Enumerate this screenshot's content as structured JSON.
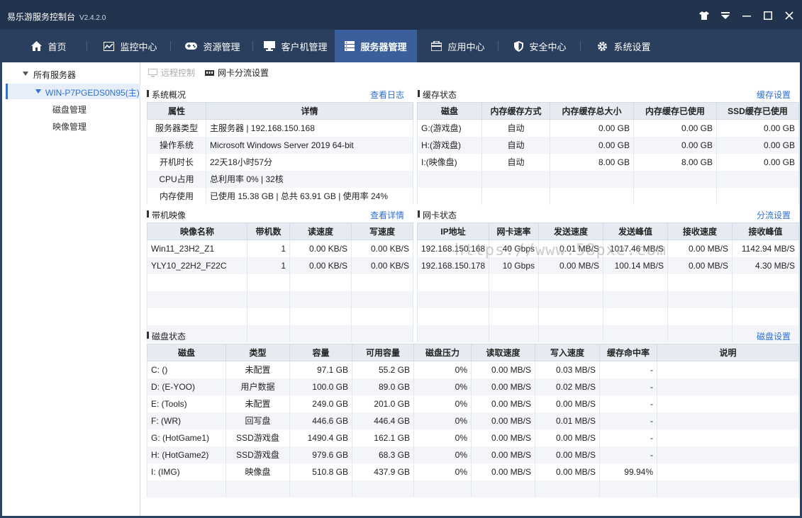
{
  "app": {
    "title": "易乐游服务控制台",
    "version": "V2.4.2.0"
  },
  "window_controls": [
    "skin-icon",
    "dropdown-icon",
    "minimize-icon",
    "maximize-icon",
    "close-icon"
  ],
  "nav": {
    "tabs": [
      {
        "label": "首页",
        "icon": "home-icon"
      },
      {
        "label": "监控中心",
        "icon": "monitor-icon"
      },
      {
        "label": "资源管理",
        "icon": "gamepad-icon"
      },
      {
        "label": "客户机管理",
        "icon": "computer-icon"
      },
      {
        "label": "服务器管理",
        "icon": "server-icon",
        "active": true
      },
      {
        "label": "应用中心",
        "icon": "app-icon"
      },
      {
        "label": "安全中心",
        "icon": "shield-icon"
      },
      {
        "label": "系统设置",
        "icon": "gear-icon"
      }
    ],
    "active_color": "#3a5f9a"
  },
  "sidebar": {
    "root": "所有服务器",
    "server": "WIN-P7PGEDS0N95(主)",
    "items": [
      "磁盘管理",
      "映像管理"
    ]
  },
  "toolbar": {
    "remote": "远程控制",
    "nic_split": "网卡分流设置"
  },
  "overview": {
    "title": "系统概况",
    "link": "查看日志",
    "headers": [
      "属性",
      "详情"
    ],
    "rows": [
      [
        "服务器类型",
        "主服务器 | 192.168.150.168"
      ],
      [
        "操作系统",
        "Microsoft Windows Server 2019 64-bit"
      ],
      [
        "开机时长",
        "22天18小时57分"
      ],
      [
        "CPU占用",
        "总利用率 0% | 32核"
      ],
      [
        "内存使用",
        "已使用 15.38 GB | 总共 63.91 GB | 使用率 24%"
      ]
    ]
  },
  "cache": {
    "title": "缓存状态",
    "link": "缓存设置",
    "headers": [
      "磁盘",
      "内存缓存方式",
      "内存缓存总大小",
      "内存缓存已使用",
      "SSD缓存已使用"
    ],
    "rows": [
      [
        "G:(游戏盘)",
        "自动",
        "0.00 GB",
        "0.00 GB",
        "0.00 GB"
      ],
      [
        "H:(游戏盘)",
        "自动",
        "0.00 GB",
        "0.00 GB",
        "0.00 GB"
      ],
      [
        "I:(映像盘)",
        "自动",
        "8.00 GB",
        "8.00 GB",
        "0.00 GB"
      ]
    ]
  },
  "boot_images": {
    "title": "带机映像",
    "link": "查看详情",
    "headers": [
      "映像名称",
      "带机数",
      "读速度",
      "写速度"
    ],
    "rows": [
      [
        "Win11_23H2_Z1",
        "1",
        "0.00 KB/S",
        "0.00 KB/S"
      ],
      [
        "YLY10_22H2_F22C",
        "1",
        "0.00 KB/S",
        "0.00 KB/S"
      ]
    ]
  },
  "nic": {
    "title": "网卡状态",
    "link": "分流设置",
    "headers": [
      "IP地址",
      "网卡速率",
      "发送速度",
      "发送峰值",
      "接收速度",
      "接收峰值"
    ],
    "rows": [
      [
        "192.168.150.168",
        "40 Gbps",
        "0.01 MB/S",
        "1017.46 MB/S",
        "0.00 MB/S",
        "1142.94 MB/S"
      ],
      [
        "192.168.150.178",
        "10 Gbps",
        "0.00 MB/S",
        "100.14 MB/S",
        "0.00 MB/S",
        "4.30 MB/S"
      ]
    ]
  },
  "disk": {
    "title": "磁盘状态",
    "link": "磁盘设置",
    "headers": [
      "磁盘",
      "类型",
      "容量",
      "可用容量",
      "磁盘压力",
      "读取速度",
      "写入速度",
      "缓存命中率",
      "说明"
    ],
    "rows": [
      [
        "C: ()",
        "未配置",
        "97.1 GB",
        "55.2 GB",
        "0%",
        "0.00 MB/S",
        "0.03 MB/S",
        "-",
        ""
      ],
      [
        "D: (E-YOO)",
        "用户数据",
        "100.0 GB",
        "89.0 GB",
        "0%",
        "0.00 MB/S",
        "0.02 MB/S",
        "-",
        ""
      ],
      [
        "E: (Tools)",
        "未配置",
        "249.0 GB",
        "201.0 GB",
        "0%",
        "0.00 MB/S",
        "0.00 MB/S",
        "-",
        ""
      ],
      [
        "F: (WR)",
        "回写盘",
        "446.6 GB",
        "446.4 GB",
        "0%",
        "0.00 MB/S",
        "0.01 MB/S",
        "-",
        ""
      ],
      [
        "G: (HotGame1)",
        "SSD游戏盘",
        "1490.4 GB",
        "162.1 GB",
        "0%",
        "0.00 MB/S",
        "0.00 MB/S",
        "-",
        ""
      ],
      [
        "H: (HotGame2)",
        "SSD游戏盘",
        "979.6 GB",
        "68.3 GB",
        "0%",
        "0.00 MB/S",
        "0.00 MB/S",
        "-",
        ""
      ],
      [
        "I: (IMG)",
        "映像盘",
        "510.8 GB",
        "437.9 GB",
        "0%",
        "0.00 MB/S",
        "0.00 MB/S",
        "99.94%",
        ""
      ]
    ]
  },
  "watermark": "https://www.58pxe.com"
}
